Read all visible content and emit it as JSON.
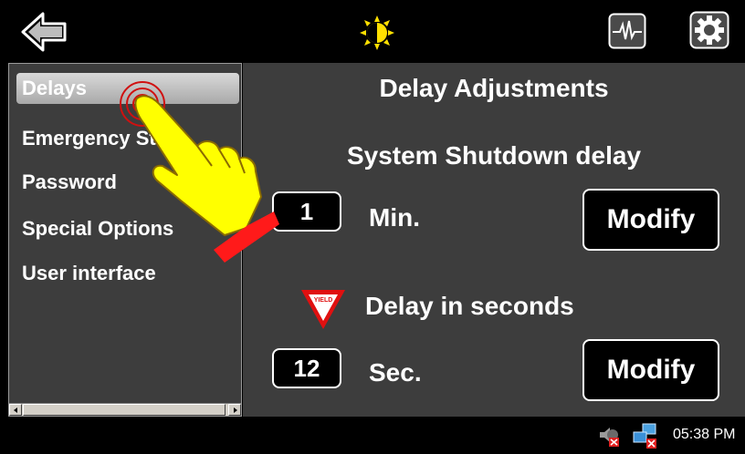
{
  "topbar": {
    "icons": [
      "back-arrow-icon",
      "brightness-icon",
      "waveform-icon",
      "gear-icon"
    ]
  },
  "sidebar": {
    "items": [
      {
        "label": "Delays",
        "selected": true
      },
      {
        "label": "Emergency Start",
        "selected": false
      },
      {
        "label": "Password",
        "selected": false
      },
      {
        "label": "Special Options",
        "selected": false
      },
      {
        "label": "User interface",
        "selected": false
      }
    ]
  },
  "main": {
    "title": "Delay Adjustments",
    "shutdown_label": "System Shutdown delay",
    "minutes_value": "1",
    "minutes_unit": "Min.",
    "modify_label": "Modify",
    "yield_text": "YIELD",
    "seconds_label": "Delay in seconds",
    "seconds_value": "12",
    "seconds_unit": "Sec."
  },
  "taskbar": {
    "clock": "05:38 PM",
    "tray_icons": [
      "volume-muted-icon",
      "network-disconnected-icon"
    ]
  },
  "colors": {
    "panel": "#3d3d3d",
    "selection": "#bfbfbf",
    "hand_fill": "#ffff00",
    "hand_cuff": "#ff1a1a",
    "yield_red": "#e01010"
  }
}
